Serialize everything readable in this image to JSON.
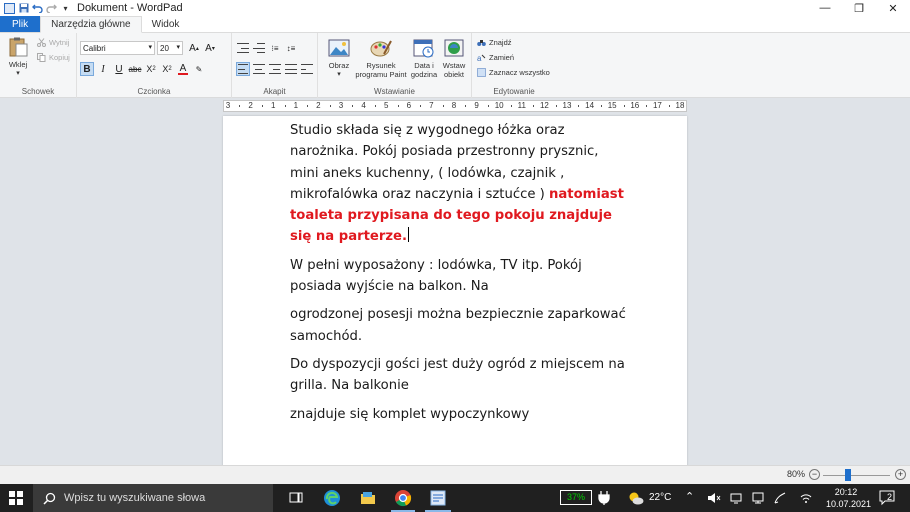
{
  "window": {
    "title": "Dokument - WordPad"
  },
  "tabs": [
    "Plik",
    "Narzędzia główne",
    "Widok"
  ],
  "ribbon": {
    "clipboard": {
      "label": "Schowek",
      "paste": "Wklej",
      "cut": "Wytnij",
      "copy": "Kopiuj"
    },
    "font": {
      "label": "Czcionka",
      "family": "Calibri",
      "size": "20"
    },
    "paragraph": {
      "label": "Akapit"
    },
    "insert": {
      "label": "Wstawianie",
      "image": "Obraz",
      "paint": "Rysunek programu Paint",
      "datetime": "Data i godzina",
      "object": "Wstaw obiekt"
    },
    "edit": {
      "label": "Edytowanie",
      "find": "Znajdź",
      "replace": "Zamień",
      "select_all": "Zaznacz wszystko"
    }
  },
  "ruler": {
    "marks": [
      "3",
      "2",
      "1",
      "1",
      "2",
      "3",
      "4",
      "5",
      "6",
      "7",
      "8",
      "9",
      "10",
      "11",
      "12",
      "13",
      "14",
      "15",
      "16",
      "17",
      "18"
    ]
  },
  "document": {
    "p1_normal": "Studio składa się z wygodnego łóżka oraz narożnika. Pokój posiada przestronny prysznic, mini aneks kuchenny, ( lodówka, czajnik , mikrofalówka oraz naczynia i sztućce ) ",
    "p1_red": "natomiast toaleta przypisana do tego pokoju znajduje się na parterze.",
    "p2": "W pełni wyposażony : lodówka, TV itp. Pokój posiada wyjście na balkon. Na",
    "p3": "ogrodzonej posesji można bezpiecznie zaparkować samochód.",
    "p4": "Do dyspozycji gości jest duży ogród z miejscem na grilla. Na balkonie",
    "p5": "znajduje się komplet wypoczynkowy"
  },
  "status": {
    "zoom": "80%",
    "zoom_level": 0.37
  },
  "taskbar": {
    "search_placeholder": "Wpisz tu wyszukiwane słowa",
    "battery": "37%",
    "weather": "22°C",
    "time": "20:12",
    "date": "10.07.2021",
    "notifications": "2"
  },
  "colors": {
    "accent": "#1e6fcc",
    "red_text": "#e0191f",
    "ribbon_bg": "#f5f6f7",
    "doc_bg": "#dfe3e8"
  }
}
